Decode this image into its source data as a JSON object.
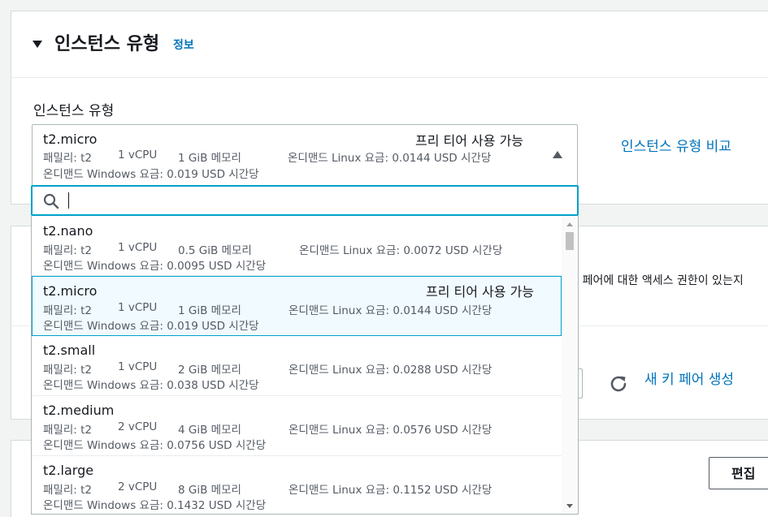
{
  "section": {
    "title": "인스턴스 유형",
    "info_link": "정보"
  },
  "field": {
    "label": "인스턴스 유형",
    "compare_link": "인스턴스 유형 비교"
  },
  "selected": {
    "name": "t2.micro",
    "tag": "프리 티어 사용 가능",
    "family": "패밀리: t2",
    "vcpu": "1 vCPU",
    "memory": "1 GiB 메모리",
    "linux_price": "온디맨드 Linux 요금: 0.0144 USD 시간당",
    "windows_price": "온디맨드 Windows 요금: 0.019 USD 시간당"
  },
  "search": {
    "placeholder": "",
    "value": ""
  },
  "options": [
    {
      "name": "t2.nano",
      "tag": "",
      "family": "패밀리: t2",
      "vcpu": "1 vCPU",
      "memory": "0.5 GiB 메모리",
      "linux_price": "온디맨드 Linux 요금: 0.0072 USD 시간당",
      "windows_price": "온디맨드 Windows 요금: 0.0095 USD 시간당",
      "selected": false
    },
    {
      "name": "t2.micro",
      "tag": "프리 티어 사용 가능",
      "family": "패밀리: t2",
      "vcpu": "1 vCPU",
      "memory": "1 GiB 메모리",
      "linux_price": "온디맨드 Linux 요금: 0.0144 USD 시간당",
      "windows_price": "온디맨드 Windows 요금: 0.019 USD 시간당",
      "selected": true
    },
    {
      "name": "t2.small",
      "tag": "",
      "family": "패밀리: t2",
      "vcpu": "1 vCPU",
      "memory": "2 GiB 메모리",
      "linux_price": "온디맨드 Linux 요금: 0.0288 USD 시간당",
      "windows_price": "온디맨드 Windows 요금: 0.038 USD 시간당",
      "selected": false
    },
    {
      "name": "t2.medium",
      "tag": "",
      "family": "패밀리: t2",
      "vcpu": "2 vCPU",
      "memory": "4 GiB 메모리",
      "linux_price": "온디맨드 Linux 요금: 0.0576 USD 시간당",
      "windows_price": "온디맨드 Windows 요금: 0.0756 USD 시간당",
      "selected": false
    },
    {
      "name": "t2.large",
      "tag": "",
      "family": "패밀리: t2",
      "vcpu": "2 vCPU",
      "memory": "8 GiB 메모리",
      "linux_price": "온디맨드 Linux 요금: 0.1152 USD 시간당",
      "windows_price": "온디맨드 Windows 요금: 0.1432 USD 시간당",
      "selected": false
    }
  ],
  "key_pair": {
    "description": "I 페어에 대한 액세스 권한이 있는지",
    "new_link": "새 키 페어 생성"
  },
  "edit_button": "편집",
  "colors": {
    "link": "#0073bb",
    "focus": "#00a1c9",
    "selected_bg": "#f1faff"
  },
  "icons": {
    "search": "search-icon",
    "refresh": "refresh-icon",
    "expand": "caret-down-icon",
    "collapse": "caret-up-icon"
  }
}
